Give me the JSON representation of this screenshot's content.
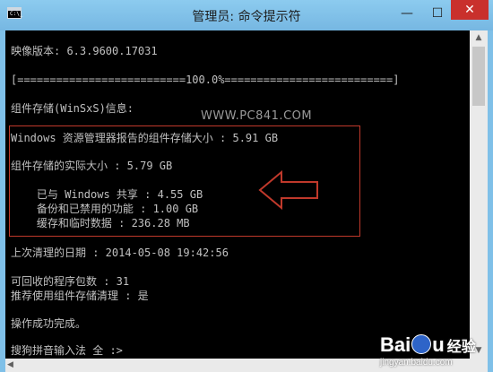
{
  "window": {
    "title": "管理员: 命令提示符",
    "icon_label": "C:\\_",
    "minimize_glyph": "—",
    "maximize_glyph": "☐",
    "close_glyph": "✕"
  },
  "console": {
    "lines": [
      "映像版本: 6.3.9600.17031",
      "[==========================100.0%==========================]",
      "组件存储(WinSxS)信息:",
      "Windows 资源管理器报告的组件存储大小 : 5.91 GB",
      "组件存储的实际大小 : 5.79 GB",
      "    已与 Windows 共享 : 4.55 GB",
      "    备份和已禁用的功能 : 1.00 GB",
      "    缓存和临时数据 : 236.28 MB",
      "上次清理的日期 : 2014-05-08 19:42:56",
      "可回收的程序包数 : 31",
      "推荐使用组件存储清理 : 是",
      "操作成功完成。",
      "搜狗拼音输入法 全 :>"
    ]
  },
  "watermark": {
    "text": "WWW.PC841.COM"
  },
  "baidu": {
    "logo_left": "Bai",
    "logo_right": "u",
    "jingyan": "经验",
    "url": "jingyan.baidu.com"
  },
  "scrollbar": {
    "up_glyph": "▲",
    "down_glyph": "▼",
    "left_glyph": "◀"
  },
  "colors": {
    "console_bg": "#000000",
    "console_text": "#c0c0c0",
    "title_bar": "#7fc0e8",
    "close_button": "#c9302c",
    "highlight_box": "#c0392b"
  },
  "icons": [
    "cmd-app-icon",
    "arrow-left-icon",
    "baidu-paw-icon"
  ]
}
